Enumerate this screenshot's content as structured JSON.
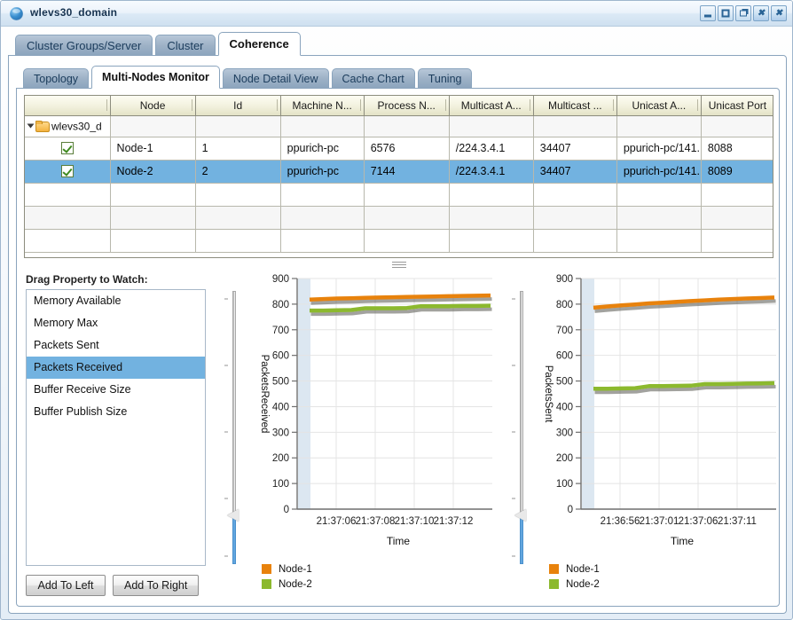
{
  "window": {
    "title": "wlevs30_domain",
    "icon": "globe-icon",
    "buttons": [
      {
        "name": "minimize",
        "glyph": "minimize-icon"
      },
      {
        "name": "maximize",
        "glyph": "maximize-icon"
      },
      {
        "name": "restore",
        "glyph": "restore-icon"
      },
      {
        "name": "close-inner",
        "glyph": "close-icon"
      },
      {
        "name": "close",
        "glyph": "close-icon"
      }
    ]
  },
  "outer_tabs": [
    {
      "label": "Cluster Groups/Server",
      "active": false
    },
    {
      "label": "Cluster",
      "active": false
    },
    {
      "label": "Coherence",
      "active": true
    }
  ],
  "inner_tabs": [
    {
      "label": "Topology",
      "active": false
    },
    {
      "label": "Multi-Nodes Monitor",
      "active": true
    },
    {
      "label": "Node Detail View",
      "active": false
    },
    {
      "label": "Cache Chart",
      "active": false
    },
    {
      "label": "Tuning",
      "active": false
    }
  ],
  "table": {
    "columns": [
      {
        "label": "",
        "width": 96
      },
      {
        "label": "Node",
        "width": 96
      },
      {
        "label": "Id",
        "width": 96
      },
      {
        "label": "Machine N...",
        "width": 94
      },
      {
        "label": "Process N...",
        "width": 96
      },
      {
        "label": "Multicast A...",
        "width": 95
      },
      {
        "label": "Multicast ...",
        "width": 94
      },
      {
        "label": "Unicast A...",
        "width": 95
      },
      {
        "label": "Unicast Port",
        "width": 82
      }
    ],
    "tree_row": {
      "label": "wlevs30_d",
      "expanded": true
    },
    "rows": [
      {
        "checked": true,
        "selected": false,
        "cells": [
          "Node-1",
          "1",
          "ppurich-pc",
          "6576",
          "/224.3.4.1",
          "34407",
          "ppurich-pc/141.",
          "8088"
        ]
      },
      {
        "checked": true,
        "selected": true,
        "cells": [
          "Node-2",
          "2",
          "ppurich-pc",
          "7144",
          "/224.3.4.1",
          "34407",
          "ppurich-pc/141.",
          "8089"
        ]
      }
    ],
    "blank_rows": 3
  },
  "properties": {
    "title": "Drag Property to Watch:",
    "items": [
      {
        "label": "Memory Available",
        "selected": false
      },
      {
        "label": "Memory Max",
        "selected": false
      },
      {
        "label": "Packets Sent",
        "selected": false
      },
      {
        "label": "Packets Received",
        "selected": true
      },
      {
        "label": "Buffer Receive Size",
        "selected": false
      },
      {
        "label": "Buffer Publish Size",
        "selected": false
      }
    ],
    "buttons": [
      {
        "label": "Add To Left"
      },
      {
        "label": "Add To Right"
      }
    ]
  },
  "colors": {
    "node1": "#E8820C",
    "node2": "#8CB92E",
    "selection": "#72b2e0",
    "shadow": "#55554f",
    "axis": "#6f6f6f",
    "grid": "#e4e4e4",
    "band": "#c6d9e8"
  },
  "chart_data": [
    {
      "id": "left",
      "type": "line",
      "title": "",
      "xlabel": "Time",
      "ylabel": "PacketsReceived",
      "ylim": [
        0,
        900
      ],
      "yticks": [
        0,
        100,
        200,
        300,
        400,
        500,
        600,
        700,
        800,
        900
      ],
      "xticks": [
        "21:37:06",
        "21:37:08",
        "21:37:10",
        "21:37:12"
      ],
      "grid": true,
      "legend_position": "bottom-left",
      "series": [
        {
          "name": "Node-1",
          "color": "#E8820C",
          "values": [
            818,
            820,
            822,
            823,
            825,
            826,
            827,
            828,
            829,
            830,
            831,
            832,
            833,
            834
          ]
        },
        {
          "name": "Node-2",
          "color": "#8CB92E",
          "values": [
            775,
            775,
            776,
            777,
            784,
            784,
            784,
            785,
            792,
            792,
            792,
            793,
            793,
            794
          ]
        }
      ]
    },
    {
      "id": "right",
      "type": "line",
      "title": "",
      "xlabel": "Time",
      "ylabel": "PacketsSent",
      "ylim": [
        0,
        900
      ],
      "yticks": [
        0,
        100,
        200,
        300,
        400,
        500,
        600,
        700,
        800,
        900
      ],
      "xticks": [
        "21:36:56",
        "21:37:01",
        "21:37:06",
        "21:37:11"
      ],
      "grid": true,
      "legend_position": "bottom-left",
      "series": [
        {
          "name": "Node-1",
          "color": "#E8820C",
          "values": [
            786,
            791,
            795,
            799,
            803,
            806,
            809,
            812,
            815,
            818,
            820,
            822,
            824,
            826
          ]
        },
        {
          "name": "Node-2",
          "color": "#8CB92E",
          "values": [
            470,
            470,
            471,
            472,
            480,
            480,
            481,
            482,
            488,
            488,
            489,
            490,
            491,
            492
          ]
        }
      ]
    }
  ]
}
